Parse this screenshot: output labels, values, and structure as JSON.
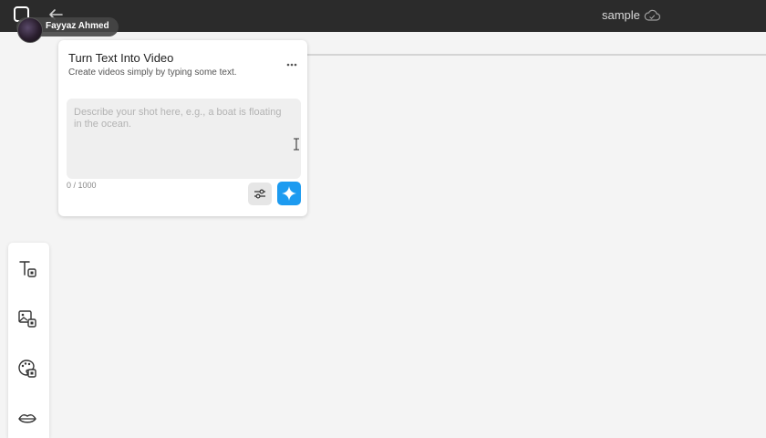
{
  "header": {
    "doc_title": "sample",
    "back_icon": "arrow-left-icon",
    "cloud_icon": "cloud-icon",
    "logo_icon": "app-logo-icon"
  },
  "user": {
    "name": "Fayyaz Ahmed"
  },
  "card": {
    "title": "Turn Text Into Video",
    "subtitle": "Create videos simply by typing some text.",
    "prompt_placeholder": "Describe your shot here, e.g., a boat is floating in the ocean.",
    "prompt_value": "",
    "char_count": "0 / 1000",
    "accent_color": "#1d9bf0"
  },
  "toolbar": {
    "tools": [
      {
        "icon": "text-tool-icon"
      },
      {
        "icon": "image-tool-icon"
      },
      {
        "icon": "palette-tool-icon"
      },
      {
        "icon": "lips-tool-icon"
      }
    ]
  }
}
